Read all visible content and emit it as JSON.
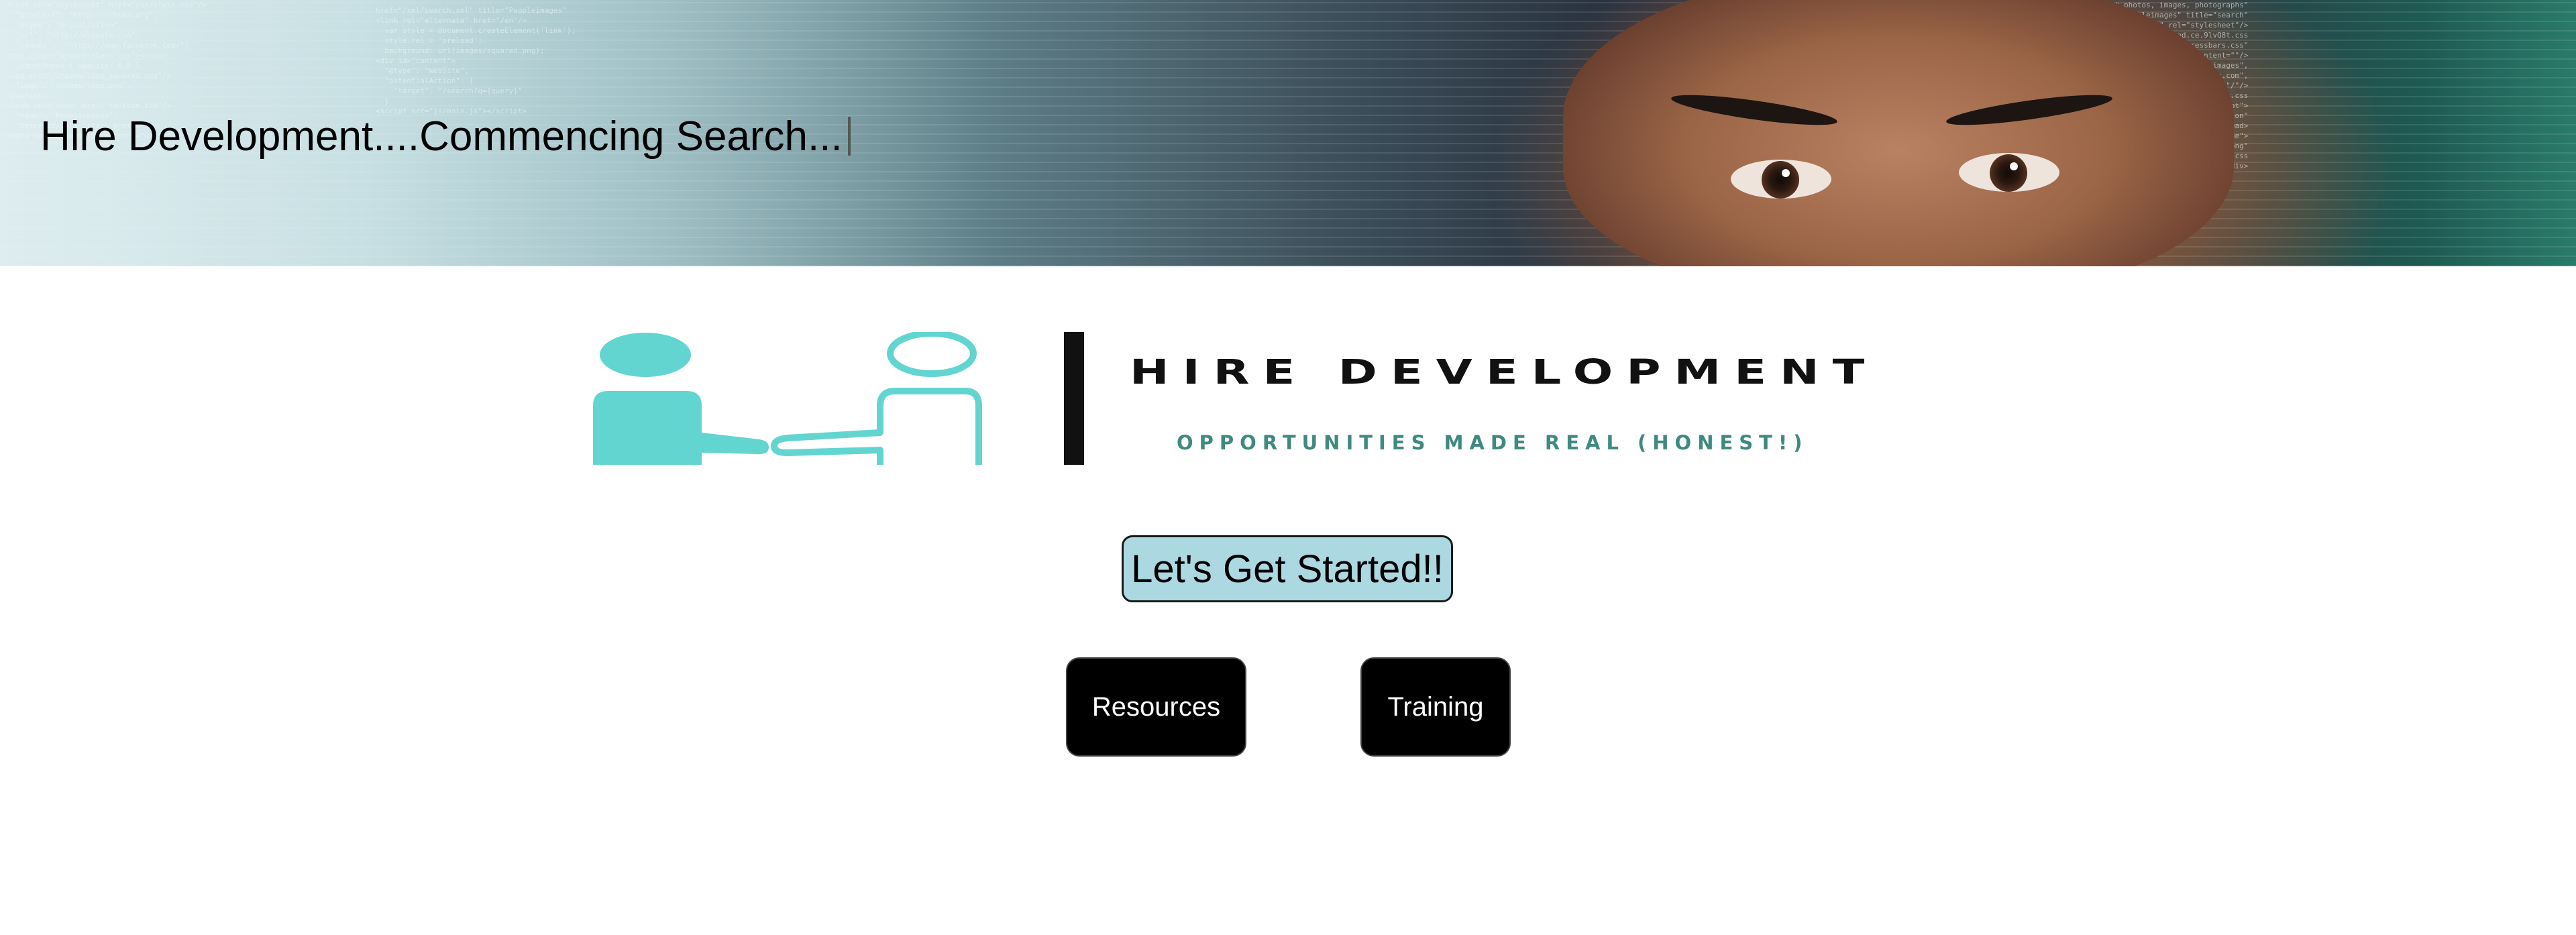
{
  "hero": {
    "typed_text": "Hire Development....Commencing Search..."
  },
  "logo": {
    "title": "HIRE DEVELOPMENT",
    "tagline": "OPPORTUNITIES MADE REAL (HONEST!)",
    "accent_color": "#63d5d1",
    "tagline_color": "#3f8a80"
  },
  "cta": {
    "label": "Let's Get Started!!",
    "color": "#acd8e2"
  },
  "nav": {
    "resources_label": "Resources",
    "training_label": "Training"
  }
}
